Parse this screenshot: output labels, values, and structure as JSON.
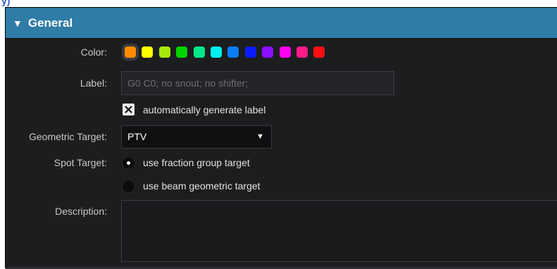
{
  "page": {
    "top_cut_text": "y)"
  },
  "section": {
    "title": "General",
    "arrow": "▼"
  },
  "color": {
    "label": "Color:",
    "swatches": [
      {
        "name": "orange",
        "hex": "#ff8c00",
        "selected": true
      },
      {
        "name": "yellow",
        "hex": "#ffff00"
      },
      {
        "name": "yellow-green",
        "hex": "#a6e80c"
      },
      {
        "name": "green",
        "hex": "#00d400"
      },
      {
        "name": "spring-green",
        "hex": "#00e887"
      },
      {
        "name": "cyan",
        "hex": "#00f0f0"
      },
      {
        "name": "azure",
        "hex": "#0a7cff"
      },
      {
        "name": "blue",
        "hex": "#0c1cff"
      },
      {
        "name": "violet",
        "hex": "#8a10ff"
      },
      {
        "name": "magenta",
        "hex": "#ff00f0"
      },
      {
        "name": "rose",
        "hex": "#ff1a8a"
      },
      {
        "name": "red",
        "hex": "#ff1010"
      }
    ]
  },
  "label_field": {
    "label": "Label:",
    "placeholder": "G0 C0; no snout; no shifter;"
  },
  "auto_label": {
    "text": "automatically generate label",
    "checked": true
  },
  "geometric_target": {
    "label": "Geometric Target:",
    "value": "PTV",
    "caret": "▼"
  },
  "spot_target": {
    "label": "Spot Target:",
    "options": [
      {
        "text": "use fraction group target",
        "selected": true
      },
      {
        "text": "use beam geometric target",
        "selected": false
      }
    ]
  },
  "description": {
    "label": "Description:",
    "value": ""
  }
}
